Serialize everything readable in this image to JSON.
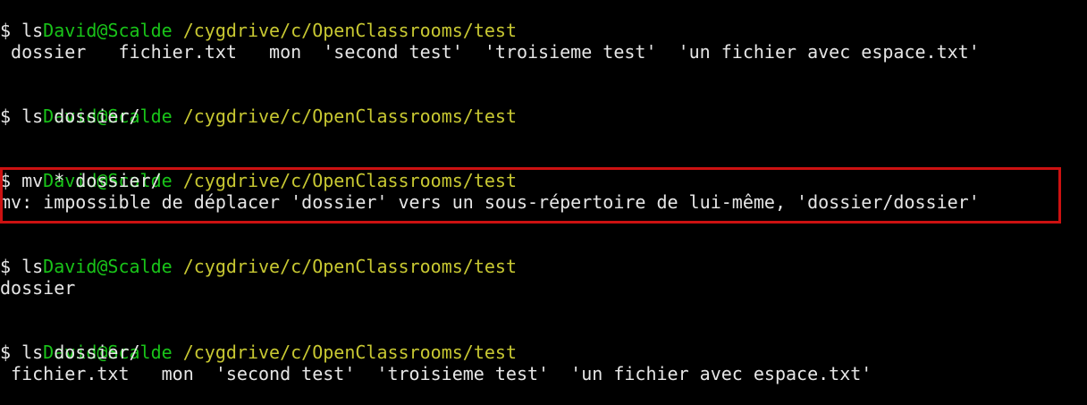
{
  "colors": {
    "background": "#000000",
    "text": "#e6e6e6",
    "user": "#19c419",
    "path": "#c8c832",
    "highlight": "#cc1111"
  },
  "prompt": {
    "user": "David@Scalde",
    "path": "/cygdrive/c/OpenClassrooms/test"
  },
  "lines": {
    "l1_cmd": "$ ls",
    "l1_out": " dossier   fichier.txt   mon  'second test'  'troisieme test'  'un fichier avec espace.txt'",
    "l2_cmd": "$ ls dossier/",
    "l3_cmd": "$ mv * dossier/",
    "l3_out": "mv: impossible de déplacer 'dossier' vers un sous-répertoire de lui-même, 'dossier/dossier'",
    "l4_cmd": "$ ls",
    "l4_out": "dossier",
    "l5_cmd": "$ ls dossier/",
    "l5_out": " fichier.txt   mon  'second test'  'troisieme test'  'un fichier avec espace.txt'"
  }
}
